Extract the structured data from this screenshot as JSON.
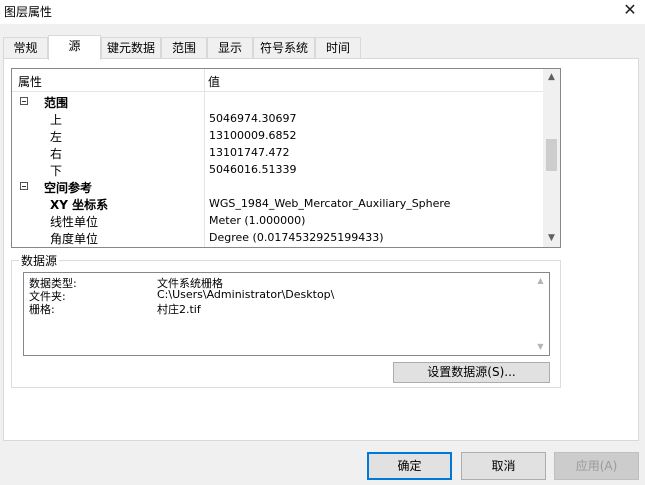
{
  "window": {
    "title": "图层属性",
    "close_icon": "close-icon"
  },
  "tabs": [
    {
      "label": "常规",
      "active": false
    },
    {
      "label": "源",
      "active": true
    },
    {
      "label": "键元数据",
      "active": false
    },
    {
      "label": "范围",
      "active": false
    },
    {
      "label": "显示",
      "active": false
    },
    {
      "label": "符号系统",
      "active": false
    },
    {
      "label": "时间",
      "active": false
    }
  ],
  "properties_grid": {
    "col_property": "属性",
    "col_value": "值",
    "rows": [
      {
        "key": "范围",
        "value": "",
        "group": true
      },
      {
        "key": "上",
        "value": "5046974.30697"
      },
      {
        "key": "左",
        "value": "13100009.6852"
      },
      {
        "key": "右",
        "value": "13101747.472"
      },
      {
        "key": "下",
        "value": "5046016.51339"
      },
      {
        "key": "空间参考",
        "value": "",
        "group": true
      },
      {
        "key": "XY 坐标系",
        "value": "WGS_1984_Web_Mercator_Auxiliary_Sphere",
        "bold": true
      },
      {
        "key": "线性单位",
        "value": "Meter (1.000000)"
      },
      {
        "key": "角度单位",
        "value": "Degree (0.0174532925199433)"
      }
    ]
  },
  "data_source": {
    "group_label": "数据源",
    "rows": [
      {
        "label": "数据类型:",
        "value": "文件系统栅格"
      },
      {
        "label": "文件夹:",
        "value": "C:\\Users\\Administrator\\Desktop\\"
      },
      {
        "label": "栅格:",
        "value": "村庄2.tif"
      }
    ],
    "set_source_button": "设置数据源(S)..."
  },
  "footer": {
    "ok": "确定",
    "cancel": "取消",
    "apply": "应用(A)"
  }
}
